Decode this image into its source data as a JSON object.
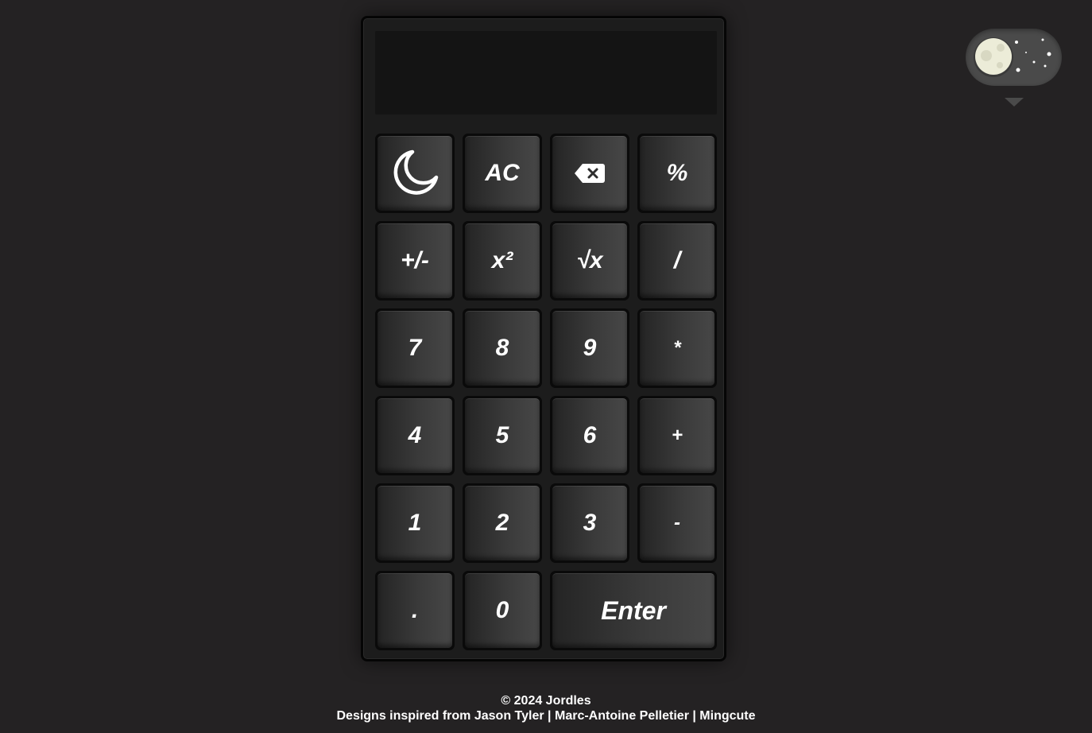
{
  "display": {
    "value": ""
  },
  "keys": {
    "theme_icon": "moon-icon",
    "ac": "AC",
    "backspace_icon": "backspace-icon",
    "percent": "%",
    "plus_minus": "+/-",
    "square": "x²",
    "sqrt": "√x",
    "divide": "/",
    "seven": "7",
    "eight": "8",
    "nine": "9",
    "multiply": "*",
    "four": "4",
    "five": "5",
    "six": "6",
    "plus": "+",
    "one": "1",
    "two": "2",
    "three": "3",
    "minus": "-",
    "decimal": ".",
    "zero": "0",
    "enter": "Enter"
  },
  "theme_toggle": {
    "state": "dark",
    "icon": "moon-icon"
  },
  "footer": {
    "copyright": "© 2024 Jordles",
    "inspired_prefix": "Designs inspired from ",
    "author1": "Jason Tyler",
    "sep": " | ",
    "author2": "Marc-Antoine Pelletier",
    "author3": "Mingcute"
  },
  "colors": {
    "background": "#242223",
    "calculator": "#1c1c1c",
    "display": "#141414",
    "key_text": "#ffffff",
    "toggle": "#4a4a4a",
    "moon": "#ececd8"
  }
}
